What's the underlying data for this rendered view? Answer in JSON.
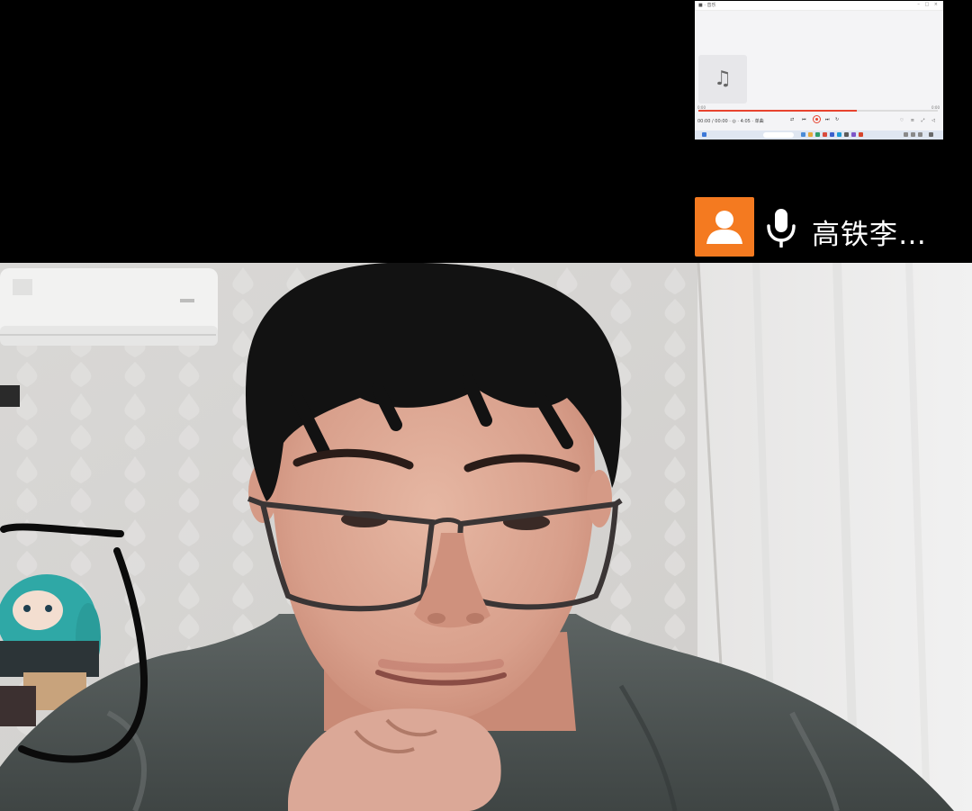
{
  "participant": {
    "name": "高铁李…",
    "avatar_icon": "person-avatar-icon",
    "mic_icon": "microphone-icon",
    "avatar_color": "#f47a20"
  },
  "shared_screen": {
    "window_title": "■ · 音乐",
    "window_buttons": "– □ ×",
    "time_elapsed": "0:00",
    "time_total": "0:00",
    "track_info": "00:00 / 00:00 · ◎ · 4:05 · 单曲",
    "progress": 0.66,
    "accent_color": "#e8442f",
    "right_controls": "♡ ≡ ⤢ ◁",
    "album_icon": "music-note-icon"
  },
  "video": {
    "accent_marking_color": "#0b0b0b"
  }
}
